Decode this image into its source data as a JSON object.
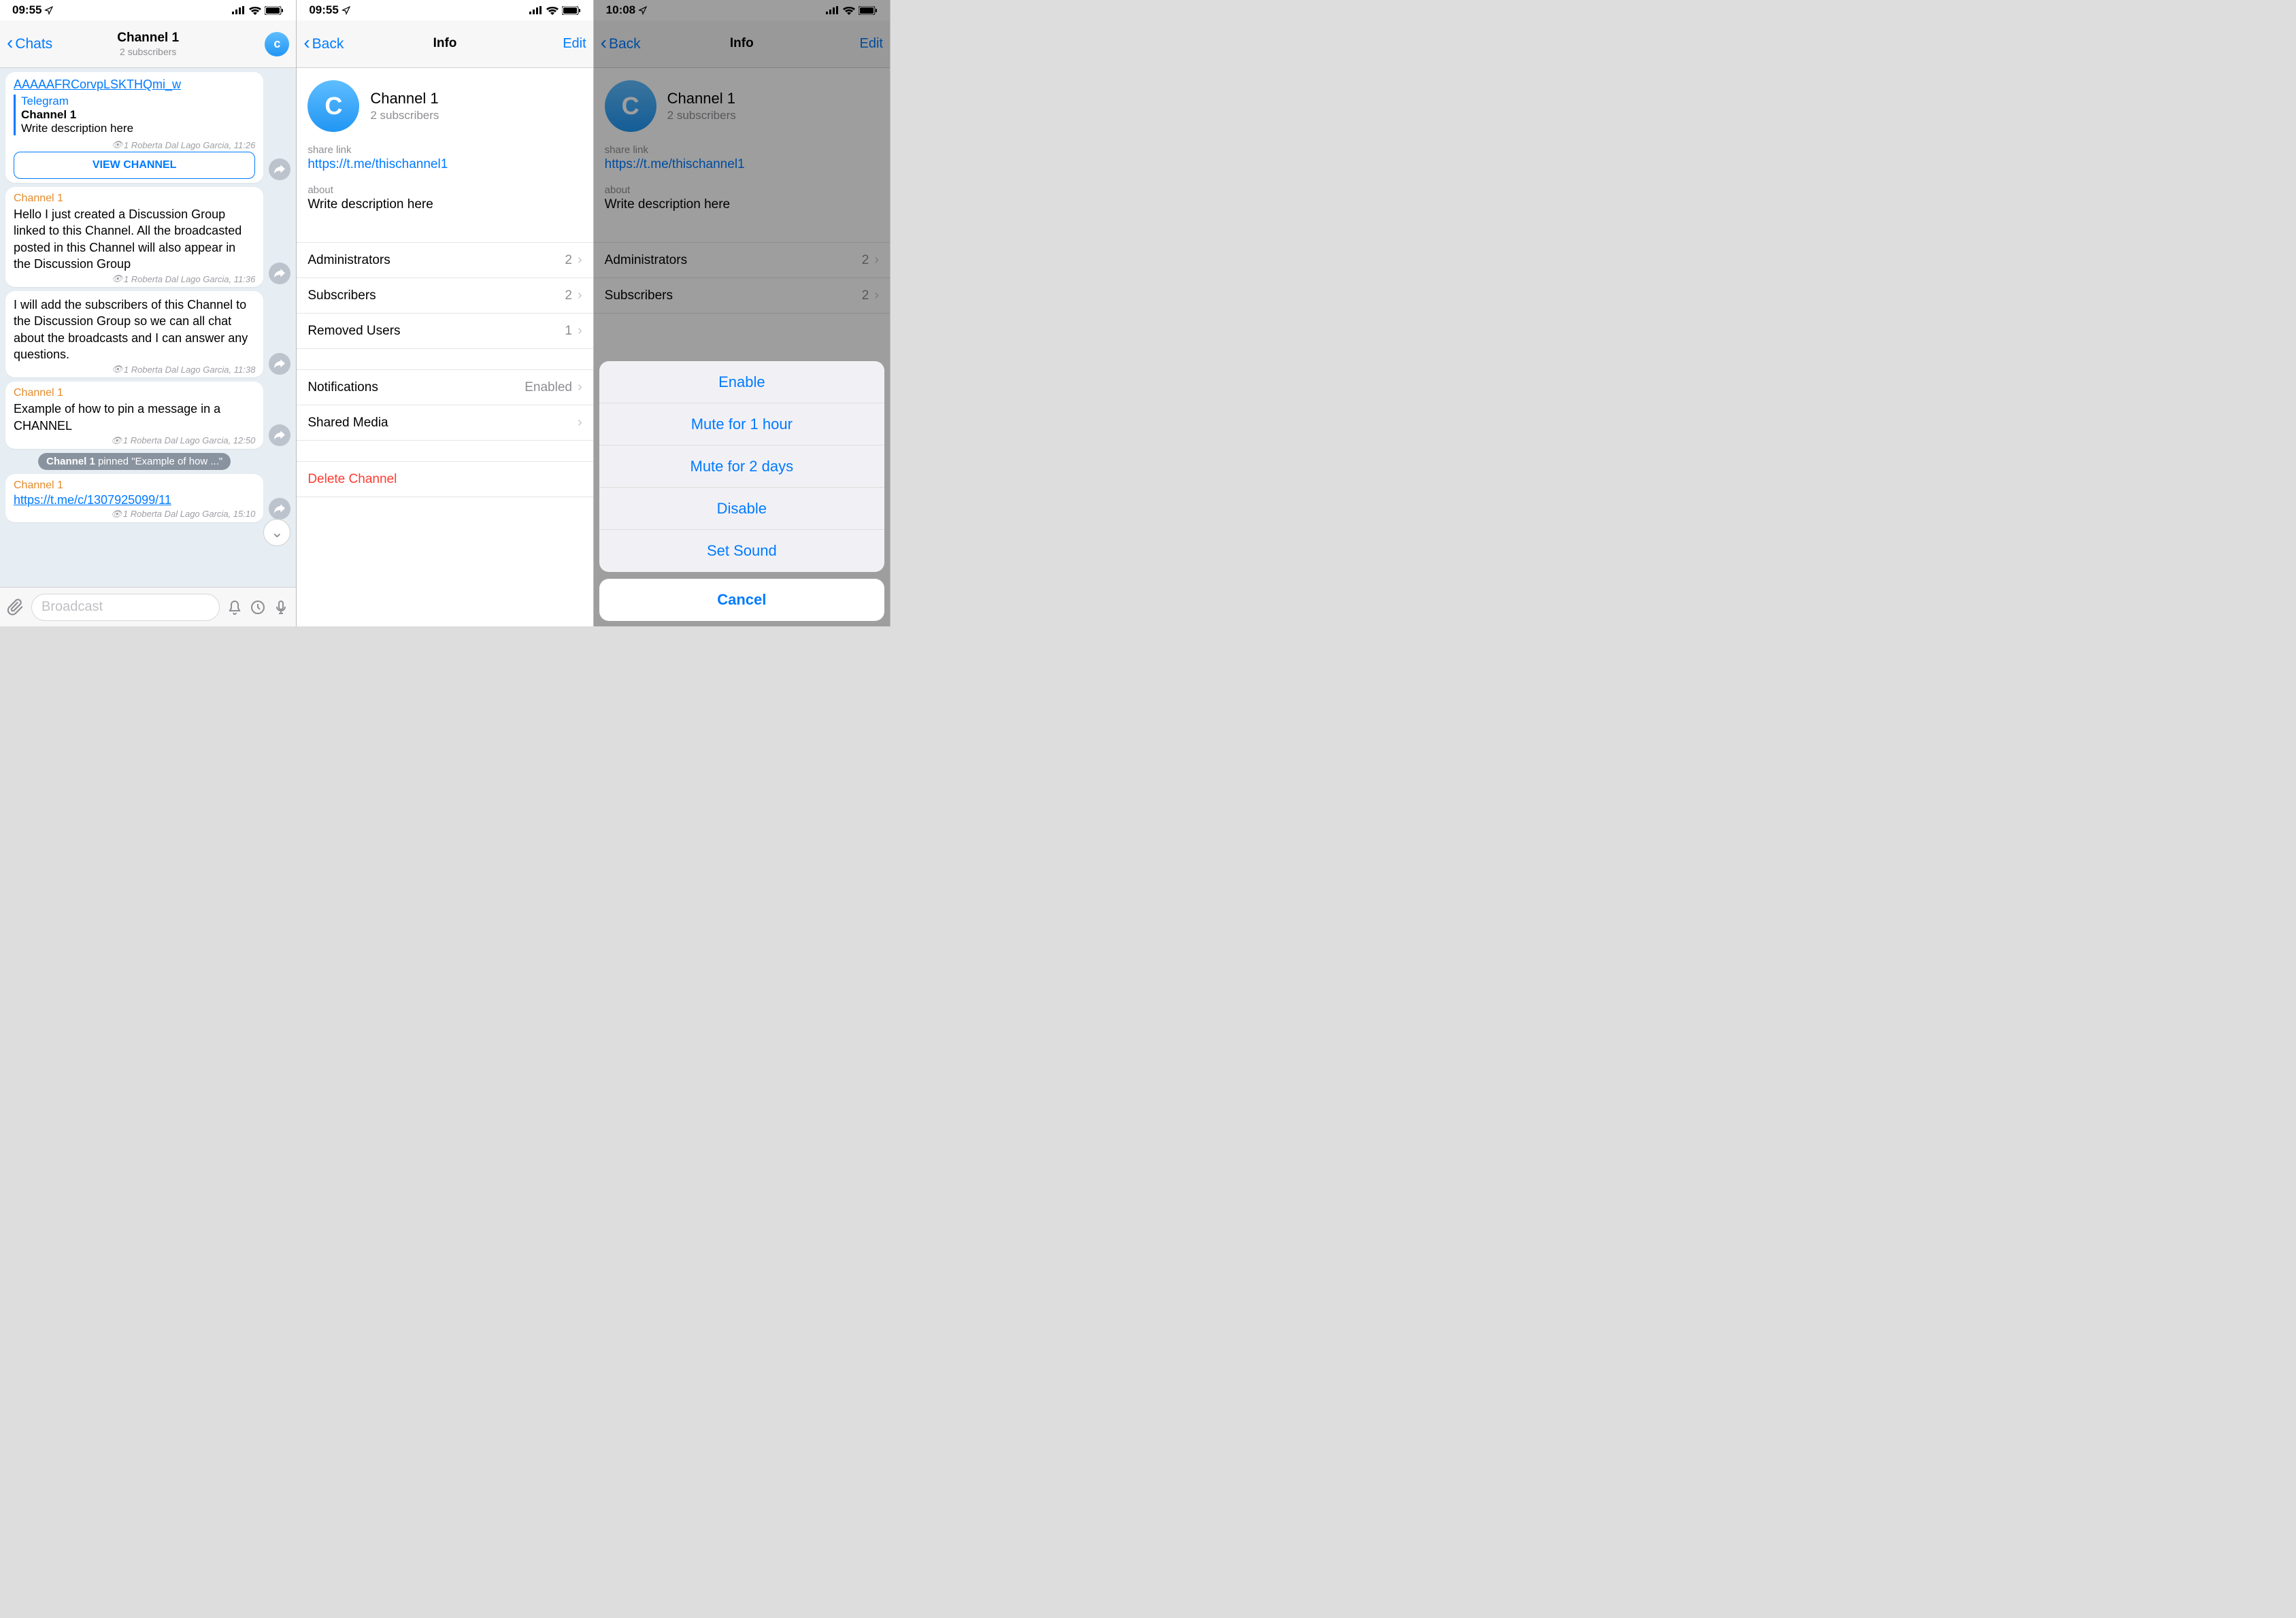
{
  "screen1": {
    "status": {
      "time": "09:55"
    },
    "nav": {
      "back": "Chats",
      "title": "Channel 1",
      "sub": "2 subscribers",
      "avatar_letter": "c"
    },
    "messages": {
      "m0_link": "AAAAAFRCorvpLSKTHQmi_w",
      "m0_embed_title": "Telegram",
      "m0_embed_name": "Channel 1",
      "m0_embed_desc": "Write description here",
      "m0_meta": "1 Roberta Dal Lago Garcia, 11:26",
      "m0_btn": "VIEW CHANNEL",
      "m1_sender": "Channel 1",
      "m1_text": "Hello I just created a Discussion Group linked to this Channel. All the broadcasted posted in this Channel will also appear in the Discussion Group",
      "m1_meta": "1 Roberta Dal Lago Garcia, 11:36",
      "m2_text": "I will add the subscribers of this Channel to the Discussion Group so we can all chat about the broadcasts and I can answer any questions.",
      "m2_meta": "1 Roberta Dal Lago Garcia, 11:38",
      "m3_sender": "Channel 1",
      "m3_text": "Example of how to pin a message in a CHANNEL",
      "m3_meta": "1 Roberta Dal Lago Garcia, 12:50",
      "service_bold": "Channel 1",
      "service_rest": " pinned \"Example of how ...\"",
      "m4_sender": "Channel 1",
      "m4_link": "https://t.me/c/1307925099/11",
      "m4_meta": "1 Roberta Dal Lago Garcia, 15:10"
    },
    "compose_placeholder": "Broadcast"
  },
  "screen2": {
    "status": {
      "time": "09:55"
    },
    "nav": {
      "back": "Back",
      "title": "Info",
      "edit": "Edit"
    },
    "header": {
      "avatar_letter": "C",
      "title": "Channel 1",
      "sub": "2 subscribers"
    },
    "sharelink_label": "share link",
    "sharelink_val": "https://t.me/thischannel1",
    "about_label": "about",
    "about_val": "Write description here",
    "rows": {
      "admins_label": "Administrators",
      "admins_val": "2",
      "subs_label": "Subscribers",
      "subs_val": "2",
      "removed_label": "Removed Users",
      "removed_val": "1",
      "notif_label": "Notifications",
      "notif_val": "Enabled",
      "media_label": "Shared Media",
      "delete_label": "Delete Channel"
    }
  },
  "screen3": {
    "status": {
      "time": "10:08"
    },
    "nav": {
      "back": "Back",
      "title": "Info",
      "edit": "Edit"
    },
    "header": {
      "avatar_letter": "C",
      "title": "Channel 1",
      "sub": "2 subscribers"
    },
    "sharelink_label": "share link",
    "sharelink_val": "https://t.me/thischannel1",
    "about_label": "about",
    "about_val": "Write description here",
    "rows": {
      "admins_label": "Administrators",
      "admins_val": "2",
      "subs_label": "Subscribers",
      "subs_val": "2"
    },
    "sheet": {
      "opt1": "Enable",
      "opt2": "Mute for 1 hour",
      "opt3": "Mute for 2 days",
      "opt4": "Disable",
      "opt5": "Set Sound",
      "cancel": "Cancel"
    }
  }
}
